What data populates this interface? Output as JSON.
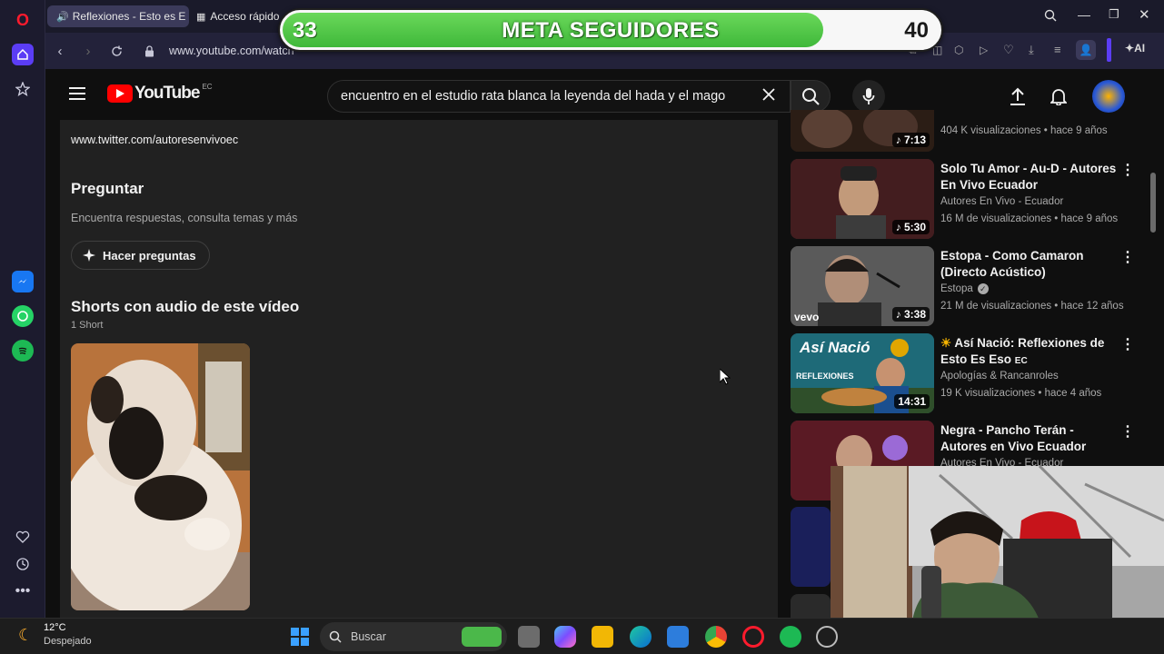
{
  "browser": {
    "tabs": [
      {
        "label": "Reflexiones - Esto es E"
      },
      {
        "label": "Acceso rápido"
      }
    ],
    "url": "www.youtube.com/watch",
    "ai_label": "AI"
  },
  "meter": {
    "title": "META SEGUIDORES",
    "current": "33",
    "goal": "40",
    "progress": 0.825
  },
  "youtube": {
    "logo_text": "YouTube",
    "region": "EC",
    "search_query": "encuentro en el estudio rata blanca la leyenda del hada y el mago"
  },
  "description": {
    "twitter_link": "www.twitter.com/autoresenvivoec",
    "ask_heading": "Preguntar",
    "ask_subtitle": "Encuentra respuestas, consulta temas y más",
    "ask_button": "Hacer preguntas",
    "shorts_heading": "Shorts con audio de este vídeo",
    "shorts_count": "1 Short"
  },
  "recommendations": [
    {
      "title": "",
      "channel": "",
      "meta": "404 K visualizaciones • hace 9 años",
      "duration": "7:13",
      "thumb_color": "#2a1f18"
    },
    {
      "title": "Solo Tu Amor - Au-D - Autores En Vivo Ecuador",
      "channel": "Autores En Vivo - Ecuador",
      "meta": "16 M de visualizaciones • hace 9 años",
      "duration": "5:30",
      "thumb_color": "#3a1d1d"
    },
    {
      "title": "Estopa - Como Camaron (Directo Acústico)",
      "channel": "Estopa",
      "meta": "21 M de visualizaciones • hace 12 años",
      "duration": "3:38",
      "thumb_color": "#4a4a4a",
      "badge": "vevo"
    },
    {
      "title": "Así Nació: Reflexiones de Esto Es Eso",
      "channel": "Apologías & Rancanroles",
      "meta": "19 K visualizaciones • hace 4 años",
      "duration": "14:31",
      "thumb_color": "#1e6a78",
      "thumb_text_1": "Así Nació",
      "thumb_text_2": "REFLEXIONES",
      "title_suffix": "EC"
    },
    {
      "title": "Negra - Pancho Terán - Autores en Vivo Ecuador",
      "channel": "Autores En Vivo - Ecuador",
      "meta": "",
      "duration": "",
      "thumb_color": "#5a1a24"
    }
  ],
  "taskbar": {
    "weather_temp": "12°C",
    "weather_desc": "Despejado",
    "search_label": "Buscar"
  },
  "colors": {
    "meter_green": "#4cc344",
    "yt_red": "#ff0000",
    "panel_bg": "#212121"
  }
}
